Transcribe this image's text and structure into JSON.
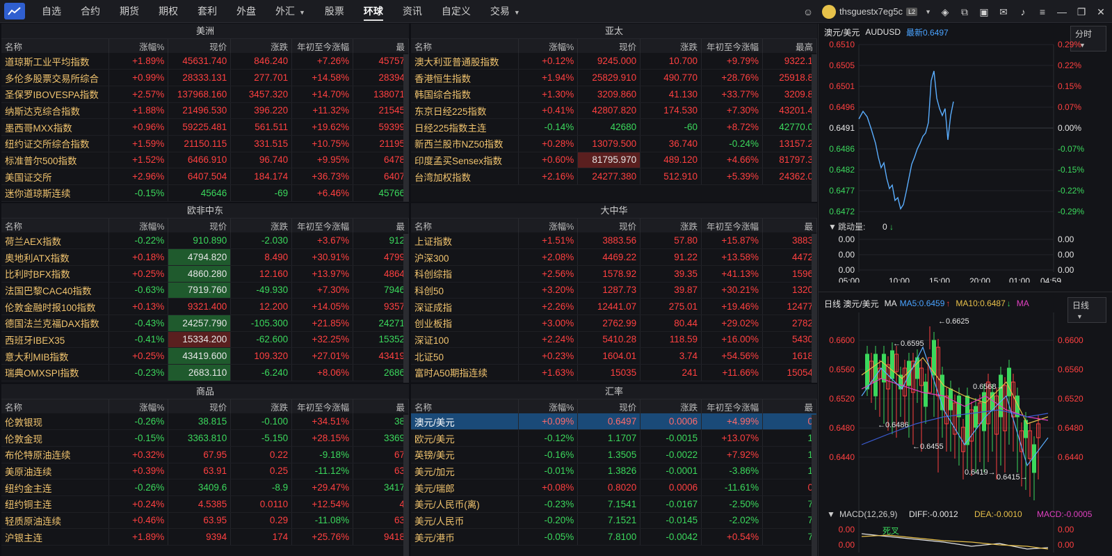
{
  "nav": {
    "items": [
      "自选",
      "合约",
      "期货",
      "期权",
      "套利",
      "外盘",
      "外汇",
      "股票",
      "环球",
      "资讯",
      "自定义",
      "交易"
    ],
    "active": "环球",
    "username": "thsguestx7eg5c",
    "level": "L2"
  },
  "panels": {
    "americas": {
      "title": "美洲",
      "headers": [
        "名称",
        "涨幅%",
        "现价",
        "涨跌",
        "年初至今涨幅",
        "最"
      ],
      "rows": [
        [
          "道琼斯工业平均指数",
          "+1.89%",
          "45631.740",
          "846.240",
          "+7.26%",
          "45757"
        ],
        [
          "多伦多股票交易所综合",
          "+0.99%",
          "28333.131",
          "277.701",
          "+14.58%",
          "28394"
        ],
        [
          "圣保罗IBOVESPA指数",
          "+2.57%",
          "137968.160",
          "3457.320",
          "+14.70%",
          "138071"
        ],
        [
          "纳斯达克综合指数",
          "+1.88%",
          "21496.530",
          "396.220",
          "+11.32%",
          "21545"
        ],
        [
          "墨西哥MXX指数",
          "+0.96%",
          "59225.481",
          "561.511",
          "+19.62%",
          "59399"
        ],
        [
          "纽约证交所综合指数",
          "+1.59%",
          "21150.115",
          "331.515",
          "+10.75%",
          "21195"
        ],
        [
          "标准普尔500指数",
          "+1.52%",
          "6466.910",
          "96.740",
          "+9.95%",
          "6478"
        ],
        [
          "美国证交所",
          "+2.96%",
          "6407.504",
          "184.174",
          "+36.73%",
          "6407"
        ],
        [
          "迷你道琼斯连续",
          "-0.15%",
          "45646",
          "-69",
          "+6.46%",
          "45766"
        ]
      ]
    },
    "asiapac": {
      "title": "亚太",
      "headers": [
        "名称",
        "涨幅%",
        "现价",
        "涨跌",
        "年初至今涨幅",
        "最高"
      ],
      "rows": [
        [
          "澳大利亚普通股指数",
          "+0.12%",
          "9245.000",
          "10.700",
          "+9.79%",
          "9322.1"
        ],
        [
          "香港恒生指数",
          "+1.94%",
          "25829.910",
          "490.770",
          "+28.76%",
          "25918.8"
        ],
        [
          "韩国综合指数",
          "+1.30%",
          "3209.860",
          "41.130",
          "+33.77%",
          "3209.8"
        ],
        [
          "东京日经225指数",
          "+0.41%",
          "42807.820",
          "174.530",
          "+7.30%",
          "43201.4"
        ],
        [
          "日经225指数主连",
          "-0.14%",
          "42680",
          "-60",
          "+8.72%",
          "42770.0"
        ],
        [
          "新西兰股市NZ50指数",
          "+0.28%",
          "13079.500",
          "36.740",
          "-0.24%",
          "13157.2"
        ],
        [
          "印度孟买Sensex指数",
          "+0.60%",
          "81795.970",
          "489.120",
          "+4.66%",
          "81797.3"
        ],
        [
          "台湾加权指数",
          "+2.16%",
          "24277.380",
          "512.910",
          "+5.39%",
          "24362.0"
        ]
      ]
    },
    "emea": {
      "title": "欧非中东",
      "headers": [
        "名称",
        "涨幅%",
        "现价",
        "涨跌",
        "年初至今涨幅",
        "最"
      ],
      "rows": [
        [
          "荷兰AEX指数",
          "-0.22%",
          "910.890",
          "-2.030",
          "+3.67%",
          "912"
        ],
        [
          "奥地利ATX指数",
          "+0.18%",
          "4794.820",
          "8.490",
          "+30.91%",
          "4799"
        ],
        [
          "比利时BFX指数",
          "+0.25%",
          "4860.280",
          "12.160",
          "+13.97%",
          "4864"
        ],
        [
          "法国巴黎CAC40指数",
          "-0.63%",
          "7919.760",
          "-49.930",
          "+7.30%",
          "7946"
        ],
        [
          "伦敦金融时报100指数",
          "+0.13%",
          "9321.400",
          "12.200",
          "+14.05%",
          "9357"
        ],
        [
          "德国法兰克福DAX指数",
          "-0.43%",
          "24257.790",
          "-105.300",
          "+21.85%",
          "24271"
        ],
        [
          "西班牙IBEX35",
          "-0.41%",
          "15334.200",
          "-62.600",
          "+32.25%",
          "15352"
        ],
        [
          "意大利MIB指数",
          "+0.25%",
          "43419.600",
          "109.320",
          "+27.01%",
          "43419"
        ],
        [
          "瑞典OMXSPI指数",
          "-0.23%",
          "2683.110",
          "-6.240",
          "+8.06%",
          "2686"
        ]
      ]
    },
    "china": {
      "title": "大中华",
      "headers": [
        "名称",
        "涨幅%",
        "现价",
        "涨跌",
        "年初至今涨幅",
        "最"
      ],
      "rows": [
        [
          "上证指数",
          "+1.51%",
          "3883.56",
          "57.80",
          "+15.87%",
          "3883"
        ],
        [
          "沪深300",
          "+2.08%",
          "4469.22",
          "91.22",
          "+13.58%",
          "4472"
        ],
        [
          "科创综指",
          "+2.56%",
          "1578.92",
          "39.35",
          "+41.13%",
          "1596"
        ],
        [
          "科创50",
          "+3.20%",
          "1287.73",
          "39.87",
          "+30.21%",
          "1320"
        ],
        [
          "深证成指",
          "+2.26%",
          "12441.07",
          "275.01",
          "+19.46%",
          "12477"
        ],
        [
          "创业板指",
          "+3.00%",
          "2762.99",
          "80.44",
          "+29.02%",
          "2782"
        ],
        [
          "深证100",
          "+2.24%",
          "5410.28",
          "118.59",
          "+16.00%",
          "5430"
        ],
        [
          "北证50",
          "+0.23%",
          "1604.01",
          "3.74",
          "+54.56%",
          "1618"
        ],
        [
          "富时A50期指连续",
          "+1.63%",
          "15035",
          "241",
          "+11.66%",
          "15054"
        ]
      ]
    },
    "commodities": {
      "title": "商品",
      "headers": [
        "名称",
        "涨幅%",
        "现价",
        "涨跌",
        "年初至今涨幅",
        "最"
      ],
      "rows": [
        [
          "伦敦银现",
          "-0.26%",
          "38.815",
          "-0.100",
          "+34.51%",
          "38"
        ],
        [
          "伦敦金现",
          "-0.15%",
          "3363.810",
          "-5.150",
          "+28.15%",
          "3369"
        ],
        [
          "布伦特原油连续",
          "+0.32%",
          "67.95",
          "0.22",
          "-9.18%",
          "67"
        ],
        [
          "美原油连续",
          "+0.39%",
          "63.91",
          "0.25",
          "-11.12%",
          "63"
        ],
        [
          "纽约金主连",
          "-0.26%",
          "3409.6",
          "-8.9",
          "+29.47%",
          "3417"
        ],
        [
          "纽约铜主连",
          "+0.24%",
          "4.5385",
          "0.0110",
          "+12.54%",
          "4"
        ],
        [
          "轻质原油连续",
          "+0.46%",
          "63.95",
          "0.29",
          "-11.08%",
          "63"
        ],
        [
          "沪银主连",
          "+1.89%",
          "9394",
          "174",
          "+25.76%",
          "9418"
        ]
      ]
    },
    "fx": {
      "title": "汇率",
      "headers": [
        "名称",
        "涨幅%",
        "现价",
        "涨跌",
        "年初至今涨幅",
        "最"
      ],
      "rows": [
        [
          "澳元/美元",
          "+0.09%",
          "0.6497",
          "0.0006",
          "+4.99%",
          "0"
        ],
        [
          "欧元/美元",
          "-0.12%",
          "1.1707",
          "-0.0015",
          "+13.07%",
          "1"
        ],
        [
          "英镑/美元",
          "-0.16%",
          "1.3505",
          "-0.0022",
          "+7.92%",
          "1"
        ],
        [
          "美元/加元",
          "-0.01%",
          "1.3826",
          "-0.0001",
          "-3.86%",
          "1"
        ],
        [
          "美元/瑞郎",
          "+0.08%",
          "0.8020",
          "0.0006",
          "-11.61%",
          "0"
        ],
        [
          "美元/人民币(离)",
          "-0.23%",
          "7.1541",
          "-0.0167",
          "-2.50%",
          "7"
        ],
        [
          "美元/人民币",
          "-0.20%",
          "7.1521",
          "-0.0145",
          "-2.02%",
          "7"
        ],
        [
          "美元/港币",
          "-0.05%",
          "7.8100",
          "-0.0042",
          "+0.54%",
          "7"
        ]
      ]
    }
  },
  "intraday": {
    "pair": "澳元/美元",
    "code": "AUDUSD",
    "latest_label": "最新0.6497",
    "period": "分时",
    "y_left": [
      "0.6510",
      "0.6505",
      "0.6501",
      "0.6496",
      "0.6491",
      "0.6486",
      "0.6482",
      "0.6477",
      "0.6472"
    ],
    "y_right": [
      "0.29%",
      "0.22%",
      "0.15%",
      "0.07%",
      "0.00%",
      "-0.07%",
      "-0.15%",
      "-0.22%",
      "-0.29%"
    ],
    "volume_label": "跳动量:",
    "volume_value": "0",
    "vol_axis": [
      "0.00",
      "0.00",
      "0.00"
    ],
    "times": [
      "05:00",
      "10:00",
      "15:00",
      "20:00",
      "01:00",
      "04:59"
    ]
  },
  "kline": {
    "title": "日线 澳元/美元",
    "ma_label": "MA",
    "ma5": "MA5:0.6459",
    "ma10": "MA10:0.6487",
    "ma_more": "MA",
    "period": "日线",
    "y_left": [
      "0.6600",
      "0.6560",
      "0.6520",
      "0.6480",
      "0.6440"
    ],
    "y_right": [
      "0.6600",
      "0.6560",
      "0.6520",
      "0.6480",
      "0.6440"
    ],
    "annotations": [
      "0.6625",
      "0.6595",
      "0.6568",
      "0.6486",
      "0.6455",
      "0.6419",
      "0.6415"
    ],
    "macd_label": "MACD(12,26,9)",
    "diff": "DIFF:-0.0012",
    "dea": "DEA:-0.0010",
    "macd": "MACD:-0.0005",
    "macd_axis": [
      "0.00",
      "0.00",
      "-0.00"
    ],
    "macd_note": "死叉"
  }
}
